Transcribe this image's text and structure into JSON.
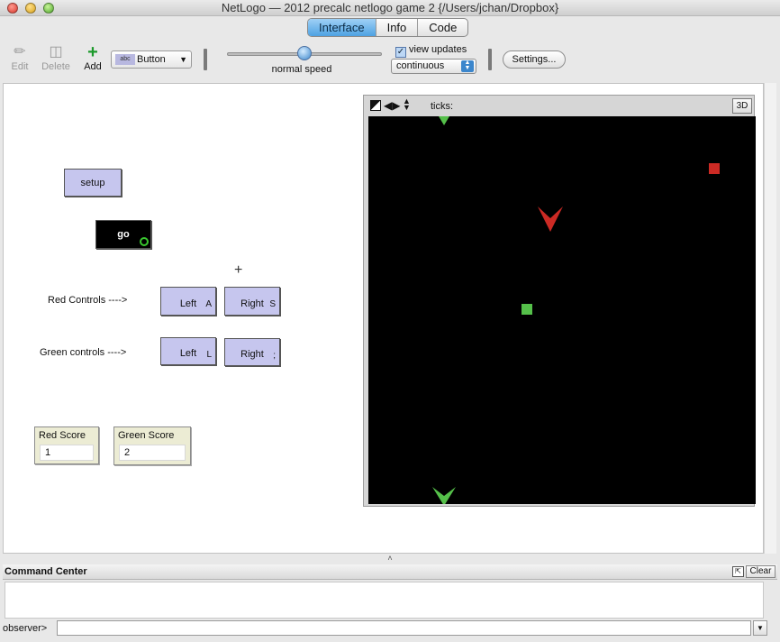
{
  "window": {
    "title": "NetLogo — 2012 precalc netlogo game 2 {/Users/jchan/Dropbox}"
  },
  "tabs": [
    {
      "label": "Interface",
      "active": true
    },
    {
      "label": "Info",
      "active": false
    },
    {
      "label": "Code",
      "active": false
    }
  ],
  "toolbar": {
    "edit_label": "Edit",
    "delete_label": "Delete",
    "add_label": "Add",
    "widget_type": "Button",
    "widget_icon_text": "abc",
    "speed_label": "normal speed",
    "speed_fraction": 0.5,
    "view_updates_label": "view updates",
    "view_updates_checked": true,
    "update_mode": "continuous",
    "settings_label": "Settings..."
  },
  "interface": {
    "setup_button": "setup",
    "go_button": "go",
    "red_controls_label": "Red Controls ---->",
    "green_controls_label": "Green controls ---->",
    "red_left": {
      "label": "Left",
      "key": "A"
    },
    "red_right": {
      "label": "Right",
      "key": "S"
    },
    "green_left": {
      "label": "Left",
      "key": "L"
    },
    "green_right": {
      "label": "Right",
      "key": ";"
    },
    "red_score": {
      "label": "Red Score",
      "value": "1"
    },
    "green_score": {
      "label": "Green Score",
      "value": "2"
    }
  },
  "view": {
    "ticks_label": "ticks:",
    "threed_label": "3D",
    "colors": {
      "background": "#000000",
      "red": "#cc2a24",
      "green": "#55c04a"
    }
  },
  "command_center": {
    "title": "Command Center",
    "clear_label": "Clear",
    "prompt": "observer>"
  }
}
